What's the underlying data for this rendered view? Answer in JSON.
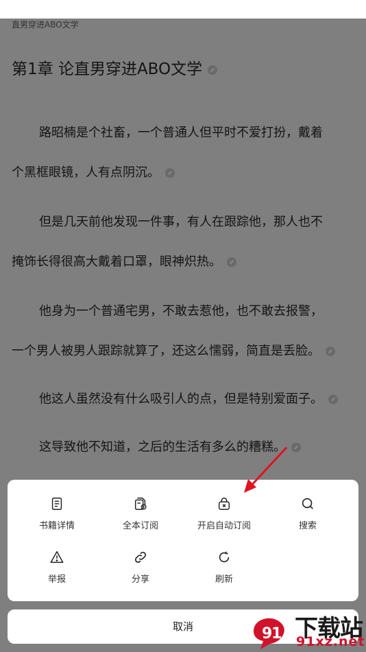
{
  "reader": {
    "book_title": "直男穿进ABO文学",
    "chapter_title": "第1章 论直男穿进ABO文学",
    "lines": [
      "路昭楠是个社畜，一个普通人但平时不爱打扮，戴着",
      "个黑框眼镜，人有点阴沉。",
      "但是几天前他发现一件事，有人在跟踪他，那人也不",
      "掩饰长得很高大戴着口罩，眼神炽热。",
      "他身为一个普通宅男，不敢去惹他，也不敢去报警，",
      "一个男人被男人跟踪就算了，还这么懦弱，简直是丢脸。",
      "他这人虽然没有什么吸引人的点，但是特别爱面子。",
      "这导致他不知道，之后的生活有多么的糟糕。"
    ]
  },
  "menu": {
    "items": [
      {
        "label": "书籍详情",
        "icon": "book-detail-icon"
      },
      {
        "label": "全本订阅",
        "icon": "subscribe-all-icon"
      },
      {
        "label": "开启自动订阅",
        "icon": "auto-subscribe-icon"
      },
      {
        "label": "搜索",
        "icon": "search-icon"
      },
      {
        "label": "举报",
        "icon": "report-icon"
      },
      {
        "label": "分享",
        "icon": "share-icon"
      },
      {
        "label": "刷新",
        "icon": "refresh-icon"
      }
    ],
    "cancel_label": "取消"
  },
  "watermark": {
    "brand_text": "下载站",
    "domain_text": "91xz.net",
    "color": "#d0122b"
  }
}
